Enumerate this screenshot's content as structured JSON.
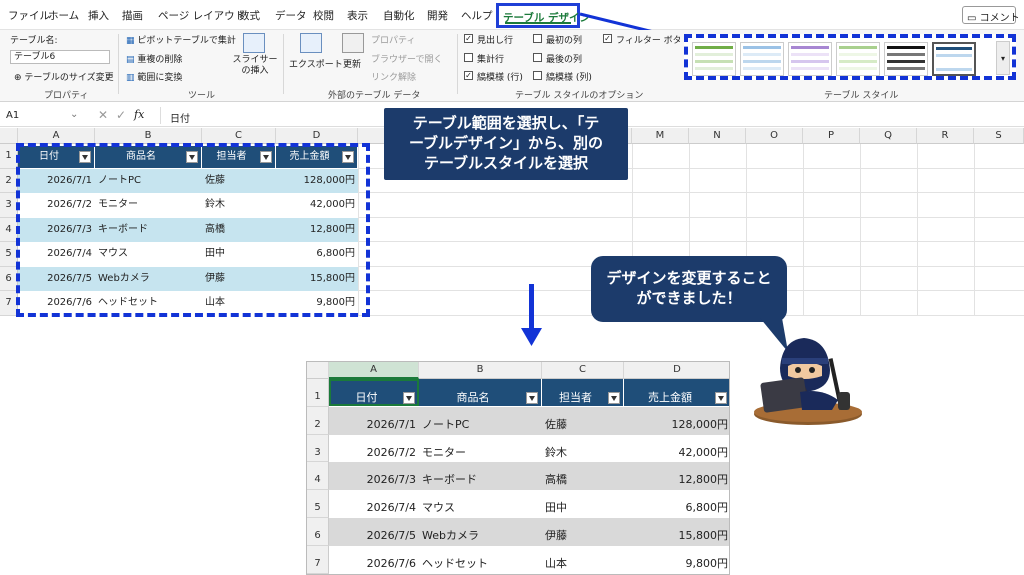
{
  "menu": {
    "items": [
      "ファイル",
      "ホーム",
      "挿入",
      "描画",
      "ページ レイアウト",
      "数式",
      "データ",
      "校閲",
      "表示",
      "自動化",
      "開発",
      "ヘルプ"
    ],
    "active_tab": "テーブル デザイン",
    "comment_label": "コメント"
  },
  "ribbon": {
    "props": {
      "table_name_label": "テーブル名:",
      "table_name_value": "テーブル6",
      "resize_label": "テーブルのサイズ変更",
      "group_label": "プロパティ"
    },
    "tools": {
      "pivot": "ピボットテーブルで集計",
      "remove_dup": "重複の削除",
      "convert": "範囲に変換",
      "slicer": "スライサーの挿入",
      "group_label": "ツール"
    },
    "external": {
      "export": "エクスポート",
      "refresh": "更新",
      "properties": "プロパティ",
      "browser": "ブラウザーで開く",
      "unlink": "リンク解除",
      "group_label": "外部のテーブル データ"
    },
    "options": {
      "header_row": "見出し行",
      "total_row": "集計行",
      "banded_rows": "縞模様 (行)",
      "first_col": "最初の列",
      "last_col": "最後の列",
      "banded_cols": "縞模様 (列)",
      "filter_btn": "フィルター ボタン",
      "group_label": "テーブル スタイルのオプション"
    },
    "styles": {
      "group_label": "テーブル スタイル"
    }
  },
  "formula_bar": {
    "name_box": "A1",
    "fx": "fx",
    "value": "日付"
  },
  "top_grid": {
    "columns": [
      "A",
      "B",
      "C",
      "D",
      "",
      "",
      "",
      "",
      "",
      "",
      "",
      "",
      "N",
      "O",
      "P",
      "Q",
      "R",
      "S"
    ],
    "row_numbers": [
      "1",
      "2",
      "3",
      "4",
      "5",
      "6",
      "7"
    ]
  },
  "table": {
    "headers": [
      "日付",
      "商品名",
      "担当者",
      "売上金額"
    ],
    "rows": [
      [
        "2026/7/1",
        "ノートPC",
        "佐藤",
        "128,000円"
      ],
      [
        "2026/7/2",
        "モニター",
        "鈴木",
        "42,000円"
      ],
      [
        "2026/7/3",
        "キーボード",
        "高橋",
        "12,800円"
      ],
      [
        "2026/7/4",
        "マウス",
        "田中",
        "6,800円"
      ],
      [
        "2026/7/5",
        "Webカメラ",
        "伊藤",
        "15,800円"
      ],
      [
        "2026/7/6",
        "ヘッドセット",
        "山本",
        "9,800円"
      ]
    ]
  },
  "bottom_grid": {
    "columns": [
      "A",
      "B",
      "C",
      "D"
    ],
    "row_numbers": [
      "1",
      "2",
      "3",
      "4",
      "5",
      "6",
      "7"
    ]
  },
  "callout_top": {
    "line1": "テーブル範囲を選択し、「テ",
    "line2": "ーブルデザイン」から、別の",
    "line3": "テーブルスタイルを選択"
  },
  "callout_bubble": {
    "line1": "デザインを変更すること",
    "line2": "ができました！"
  },
  "colors": {
    "header_blue": "#1f4e79",
    "band_top": "#c6e4ef",
    "band_bottom": "#d9d9d9",
    "dash": "#1233d6",
    "callout": "#1c3b6b"
  }
}
